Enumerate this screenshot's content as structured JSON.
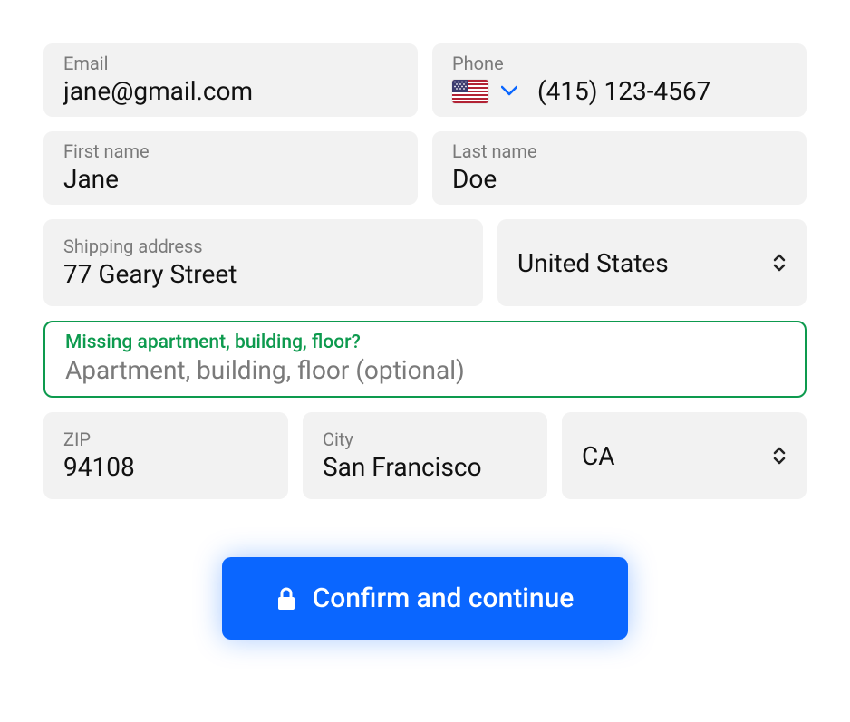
{
  "email": {
    "label": "Email",
    "value": "jane@gmail.com"
  },
  "phone": {
    "label": "Phone",
    "value": "(415) 123-4567",
    "country": "US"
  },
  "first_name": {
    "label": "First name",
    "value": "Jane"
  },
  "last_name": {
    "label": "Last name",
    "value": "Doe"
  },
  "shipping_address": {
    "label": "Shipping address",
    "value": "77 Geary Street"
  },
  "country": {
    "value": "United States"
  },
  "apartment": {
    "label": "Missing apartment, building, floor?",
    "placeholder": "Apartment, building, floor (optional)",
    "value": ""
  },
  "zip": {
    "label": "ZIP",
    "value": "94108"
  },
  "city": {
    "label": "City",
    "value": "San Francisco"
  },
  "state": {
    "value": "CA"
  },
  "confirm_button": "Confirm and continue"
}
